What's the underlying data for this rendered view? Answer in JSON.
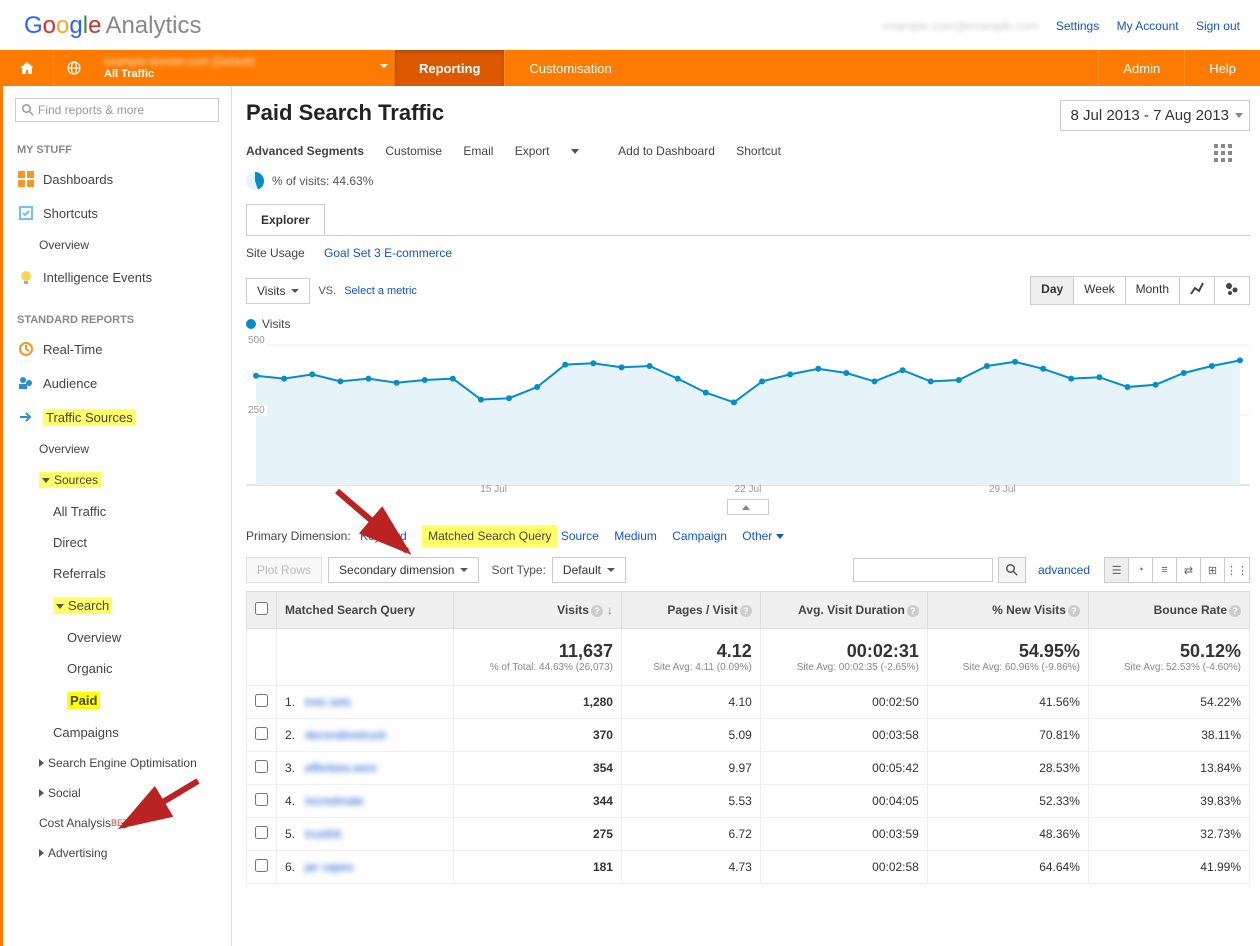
{
  "top": {
    "analytics_label": "Analytics",
    "user_email": "example.user@example.com",
    "settings": "Settings",
    "my_account": "My Account",
    "sign_out": "Sign out"
  },
  "orange": {
    "acct_line1": "example-domain.com (Default)",
    "acct_line2": "All Traffic",
    "reporting": "Reporting",
    "customisation": "Customisation",
    "admin": "Admin",
    "help": "Help"
  },
  "sidebar": {
    "search_placeholder": "Find reports & more",
    "my_stuff": "MY STUFF",
    "dashboards": "Dashboards",
    "shortcuts": "Shortcuts",
    "overview": "Overview",
    "intel_events": "Intelligence Events",
    "standard_reports": "STANDARD REPORTS",
    "real_time": "Real-Time",
    "audience": "Audience",
    "traffic_sources": "Traffic Sources",
    "sources": "Sources",
    "all_traffic": "All Traffic",
    "direct": "Direct",
    "referrals": "Referrals",
    "search": "Search",
    "organic": "Organic",
    "paid": "Paid",
    "campaigns": "Campaigns",
    "seo": "Search Engine Optimisation",
    "social": "Social",
    "cost_analysis": "Cost Analysis",
    "beta": "BETA",
    "advertising": "Advertising"
  },
  "page": {
    "title": "Paid Search Traffic",
    "date_range": "8 Jul 2013 - 7 Aug 2013",
    "adv_segments": "Advanced Segments",
    "customise": "Customise",
    "email": "Email",
    "export": "Export",
    "add_dashboard": "Add to Dashboard",
    "shortcut": "Shortcut",
    "pct_visits": "% of visits: 44.63%",
    "explorer": "Explorer",
    "site_usage": "Site Usage",
    "goal_set": "Goal Set 3",
    "ecommerce": "E-commerce",
    "visits_metric": "Visits",
    "vs": "VS.",
    "select_metric": "Select a metric",
    "day": "Day",
    "week": "Week",
    "month": "Month",
    "visits_legend": "Visits",
    "primary_dimension": "Primary Dimension:",
    "dim_keyword": "Keyword",
    "dim_matched": "Matched Search Query",
    "dim_source": "Source",
    "dim_medium": "Medium",
    "dim_campaign": "Campaign",
    "dim_other": "Other",
    "plot_rows": "Plot Rows",
    "secondary_dim": "Secondary dimension",
    "sort_type": "Sort Type:",
    "sort_default": "Default",
    "advanced_link": "advanced"
  },
  "table": {
    "col_query": "Matched Search Query",
    "col_visits": "Visits",
    "col_pages": "Pages / Visit",
    "col_duration": "Avg. Visit Duration",
    "col_new": "% New Visits",
    "col_bounce": "Bounce Rate",
    "summary": {
      "visits": "11,637",
      "visits_sub": "% of Total: 44.63% (26,073)",
      "pages": "4.12",
      "pages_sub": "Site Avg: 4.11 (0.09%)",
      "duration": "00:02:31",
      "duration_sub": "Site Avg: 00:02:35 (-2.65%)",
      "new": "54.95%",
      "new_sub": "Site Avg: 60.96% (-9.86%)",
      "bounce": "50.12%",
      "bounce_sub": "Site Avg: 52.53% (-4.60%)"
    },
    "rows": [
      {
        "n": "1.",
        "kw": "tree sets",
        "visits": "1,280",
        "pages": "4.10",
        "dur": "00:02:50",
        "new": "41.56%",
        "bounce": "54.22%"
      },
      {
        "n": "2.",
        "kw": "decorativetruck",
        "visits": "370",
        "pages": "5.09",
        "dur": "00:03:58",
        "new": "70.81%",
        "bounce": "38.11%"
      },
      {
        "n": "3.",
        "kw": "efferkies.eem",
        "visits": "354",
        "pages": "9.97",
        "dur": "00:05:42",
        "new": "28.53%",
        "bounce": "13.84%"
      },
      {
        "n": "4.",
        "kw": "incredmale",
        "visits": "344",
        "pages": "5.53",
        "dur": "00:04:05",
        "new": "52.33%",
        "bounce": "39.83%"
      },
      {
        "n": "5.",
        "kw": "trusthit",
        "visits": "275",
        "pages": "6.72",
        "dur": "00:03:59",
        "new": "48.36%",
        "bounce": "32.73%"
      },
      {
        "n": "6.",
        "kw": "jar capes",
        "visits": "181",
        "pages": "4.73",
        "dur": "00:02:58",
        "new": "64.64%",
        "bounce": "41.99%"
      }
    ]
  },
  "chart_data": {
    "type": "line",
    "title": "",
    "xlabel": "",
    "ylabel": "Visits",
    "ylim": [
      0,
      500
    ],
    "x_ticks": [
      "15 Jul",
      "22 Jul",
      "29 Jul"
    ],
    "series": [
      {
        "name": "Visits",
        "color": "#058dc7",
        "values": [
          390,
          380,
          395,
          370,
          380,
          365,
          375,
          380,
          305,
          310,
          350,
          430,
          435,
          420,
          425,
          380,
          330,
          295,
          370,
          395,
          415,
          400,
          370,
          410,
          370,
          375,
          425,
          440,
          415,
          380,
          385,
          350,
          358,
          400,
          425,
          445
        ]
      }
    ]
  }
}
